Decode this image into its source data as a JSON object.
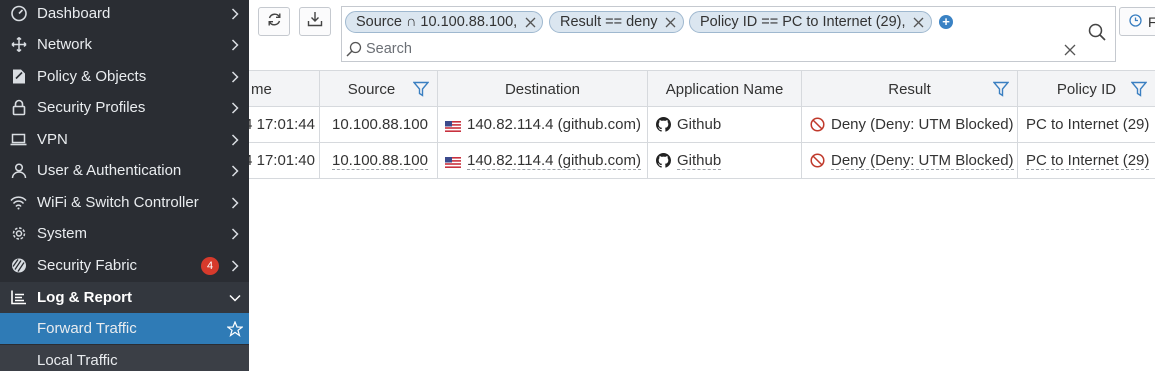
{
  "sidebar": {
    "items": [
      {
        "label": "Dashboard",
        "icon": "dashboard-icon"
      },
      {
        "label": "Network",
        "icon": "network-icon"
      },
      {
        "label": "Policy & Objects",
        "icon": "policy-icon"
      },
      {
        "label": "Security Profiles",
        "icon": "lock-icon"
      },
      {
        "label": "VPN",
        "icon": "laptop-icon"
      },
      {
        "label": "User & Authentication",
        "icon": "user-icon"
      },
      {
        "label": "WiFi & Switch Controller",
        "icon": "wifi-icon"
      },
      {
        "label": "System",
        "icon": "gear-icon"
      },
      {
        "label": "Security Fabric",
        "icon": "fabric-icon",
        "badge": "4"
      }
    ],
    "section": {
      "label": "Log & Report",
      "icon": "log-report-icon"
    },
    "subitems": [
      {
        "label": "Forward Traffic",
        "active": true
      },
      {
        "label": "Local Traffic",
        "active": false
      }
    ]
  },
  "toolbar": {
    "filters": [
      {
        "label": "Source ∩ 10.100.88.100,"
      },
      {
        "label": "Result == deny"
      },
      {
        "label": "Policy ID == PC to Internet (29),"
      }
    ],
    "search_placeholder": "Search",
    "right_button_label": "F"
  },
  "table": {
    "columns": [
      {
        "label": "me",
        "filter": false
      },
      {
        "label": "Source",
        "filter": true
      },
      {
        "label": "Destination",
        "filter": false
      },
      {
        "label": "Application Name",
        "filter": false
      },
      {
        "label": "Result",
        "filter": true
      },
      {
        "label": "Policy ID",
        "filter": true
      }
    ],
    "rows": [
      {
        "time": "4 17:01:44",
        "source": "10.100.88.100",
        "destination": "140.82.114.4 (github.com)",
        "app": "Github",
        "result": "Deny (Deny: UTM Blocked)",
        "policy": "PC to Internet (29)"
      },
      {
        "time": "4 17:01:40",
        "source": "10.100.88.100",
        "destination": "140.82.114.4 (github.com)",
        "app": "Github",
        "result": "Deny (Deny: UTM Blocked)",
        "policy": "PC to Internet (29)"
      }
    ]
  },
  "colors": {
    "sidebar_bg": "#2a2d33",
    "active_item": "#2f7bb6",
    "badge": "#d63a2c",
    "deny_red": "#c0392b",
    "chip_bg": "#dbe6f0",
    "filter_icon": "#3a7fc1"
  }
}
